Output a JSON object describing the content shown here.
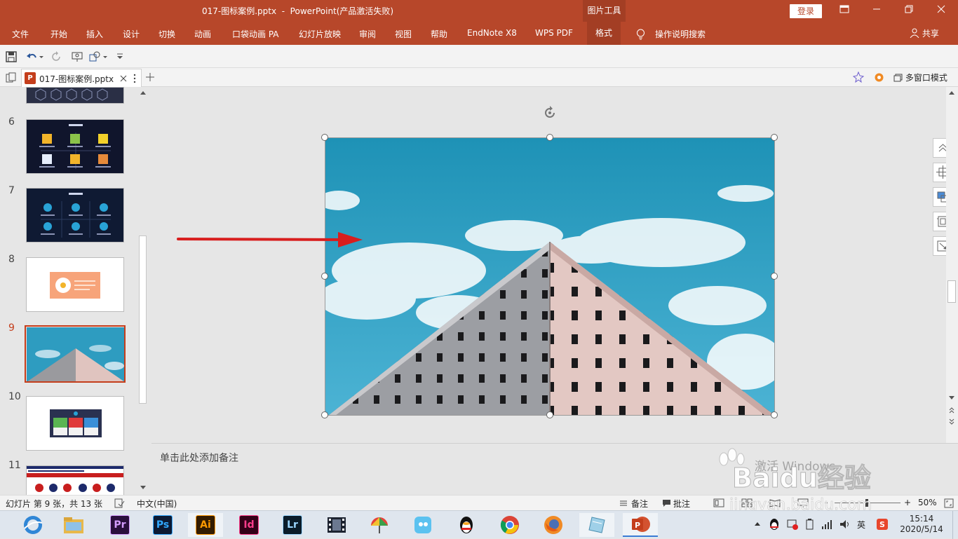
{
  "title_bar": {
    "document_title": "017-图标案例.pptx  -  PowerPoint(产品激活失败)",
    "context_tab_group": "图片工具",
    "login": "登录",
    "buttons": [
      "restore-ribbon-icon",
      "minimize-icon",
      "maximize-icon",
      "close-icon"
    ]
  },
  "ribbon": {
    "tabs": [
      "文件",
      "开始",
      "插入",
      "设计",
      "切换",
      "动画",
      "口袋动画 PA",
      "幻灯片放映",
      "审阅",
      "视图",
      "帮助",
      "EndNote X8",
      "WPS PDF",
      "格式"
    ],
    "active_tab": "格式",
    "tell_me": "操作说明搜索",
    "share": "共享"
  },
  "document_tab": {
    "name": "017-图标案例.pptx",
    "app_badge": "P",
    "multi_window": "多窗口模式"
  },
  "slides_panel": {
    "slide_numbers": [
      "6",
      "7",
      "8",
      "9",
      "10",
      "11"
    ],
    "current": "9"
  },
  "notes": {
    "placeholder": "单击此处添加备注"
  },
  "status_bar": {
    "slide_info": "幻灯片 第 9 张，共 13 张",
    "language": "中文(中国)",
    "notes": "备注",
    "comments": "批注",
    "zoom": "50%",
    "zoom_minus": "-",
    "zoom_plus": "+"
  },
  "taskbar": {
    "apps": [
      "browser",
      "file-explorer",
      "Pr",
      "Ps",
      "Ai",
      "Id",
      "Lr",
      "video-editor",
      "photos",
      "im-app",
      "qq",
      "chrome",
      "firefox",
      "notes",
      "powerpoint"
    ],
    "app_labels": {
      "pr": "Pr",
      "ps": "Ps",
      "ai": "Ai",
      "id": "Id",
      "lr": "Lr",
      "ppt": "P"
    },
    "ime": "英",
    "time": "15:14",
    "date": "2020/5/14"
  },
  "watermark": {
    "activate": "激活 Windows",
    "baidu": "Baidu经验",
    "url": "jingyan.baidu.com"
  },
  "colors": {
    "accent": "#b7472a",
    "accent_dark": "#a33e24",
    "sky": "#2e9cc0",
    "arrow": "#d81e1e"
  }
}
